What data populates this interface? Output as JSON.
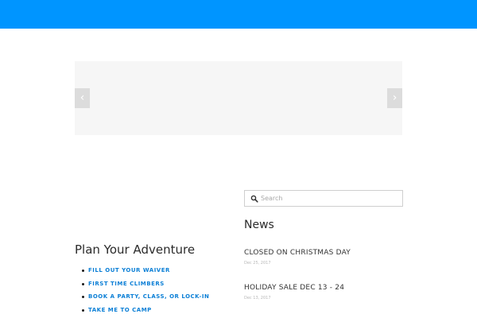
{
  "colors": {
    "header": "#0095ff",
    "link": "#0b7fd6"
  },
  "slider": {
    "prev_icon": "chevron-left",
    "next_icon": "chevron-right",
    "prev_glyph": "‹",
    "next_glyph": "›"
  },
  "plan": {
    "title": "Plan Your Adventure",
    "links": [
      "FILL OUT YOUR WAIVER",
      "FIRST TIME CLIMBERS",
      "BOOK A PARTY, CLASS, OR LOCK-IN",
      "TAKE ME TO CAMP"
    ]
  },
  "search": {
    "placeholder": "Search",
    "icon": "search-icon"
  },
  "news": {
    "title": "News",
    "items": [
      {
        "title": "CLOSED ON CHRISTMAS DAY",
        "date": "Dec 25, 2017"
      },
      {
        "title": "HOLIDAY SALE DEC 13 - 24",
        "date": "Dec 13, 2017"
      }
    ]
  }
}
